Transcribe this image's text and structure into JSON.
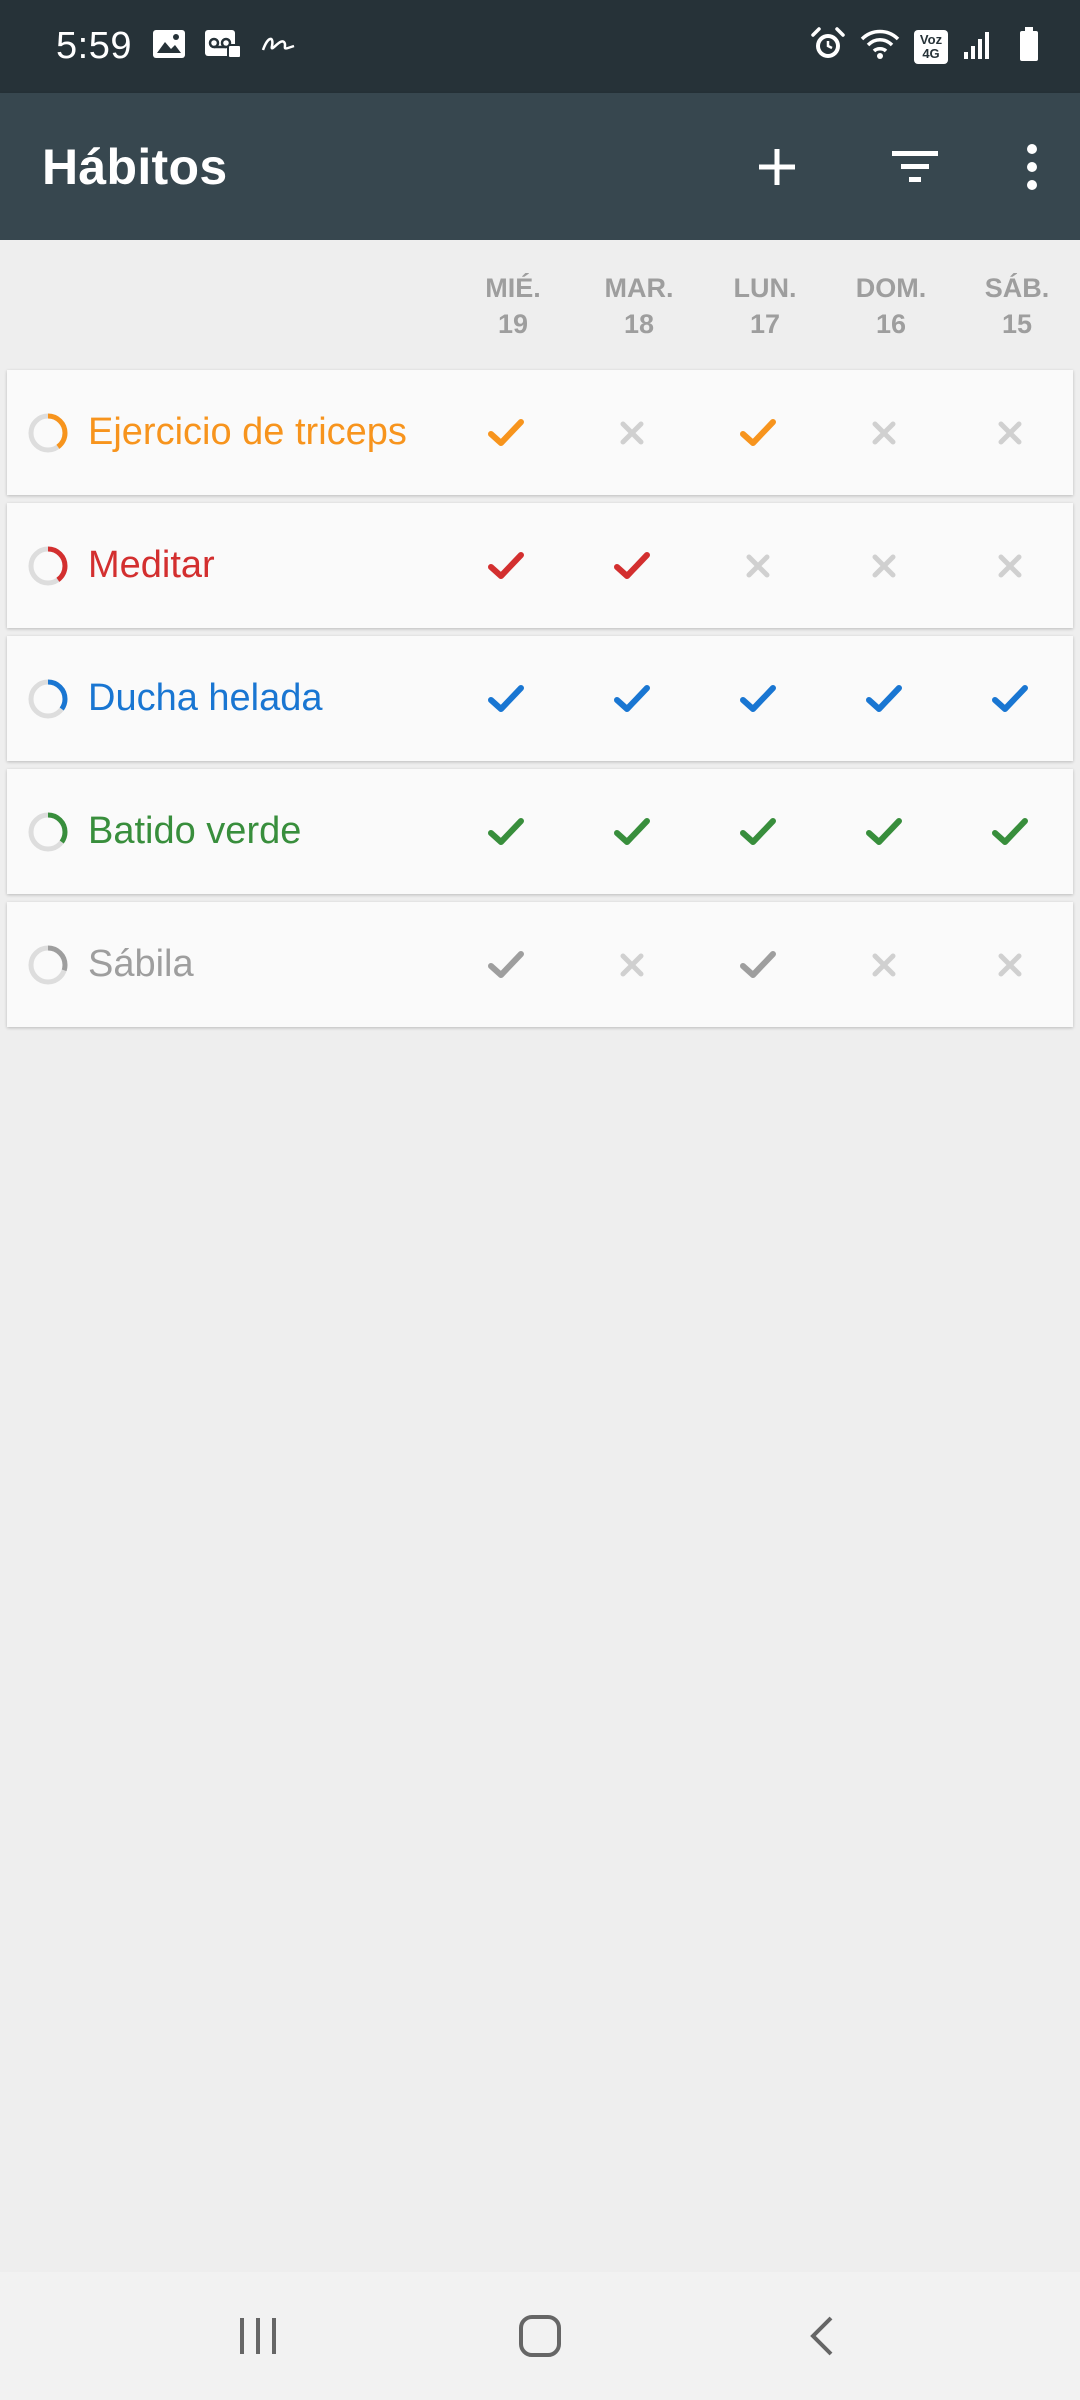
{
  "status_bar": {
    "time": "5:59",
    "left_icons": [
      "image-icon",
      "voicemail-icon",
      "signature-icon"
    ],
    "right_icons": [
      "alarm-icon",
      "wifi-icon",
      "volte-4g-icon",
      "signal-icon",
      "battery-icon"
    ],
    "network_badge_top": "Voz",
    "network_badge_bottom": "4G"
  },
  "app_bar": {
    "title": "Hábitos",
    "actions": [
      "add-icon",
      "filter-icon",
      "more-vert-icon"
    ]
  },
  "days": [
    {
      "name": "MIÉ.",
      "num": "19"
    },
    {
      "name": "MAR.",
      "num": "18"
    },
    {
      "name": "LUN.",
      "num": "17"
    },
    {
      "name": "DOM.",
      "num": "16"
    },
    {
      "name": "SÁB.",
      "num": "15"
    }
  ],
  "colors": {
    "check_off": "#d0d0d0",
    "ring_track": "#dddddd"
  },
  "habits": [
    {
      "name": "Ejercicio de triceps",
      "color": "#f7941d",
      "progress": 0.4,
      "checks": [
        true,
        false,
        true,
        false,
        false
      ]
    },
    {
      "name": "Meditar",
      "color": "#d32f2f",
      "progress": 0.4,
      "checks": [
        true,
        true,
        false,
        false,
        false
      ]
    },
    {
      "name": "Ducha helada",
      "color": "#1976d2",
      "progress": 0.35,
      "checks": [
        true,
        true,
        true,
        true,
        true
      ]
    },
    {
      "name": "Batido verde",
      "color": "#388e3c",
      "progress": 0.35,
      "checks": [
        true,
        true,
        true,
        true,
        true
      ]
    },
    {
      "name": "Sábila",
      "color": "#9e9e9e",
      "progress": 0.3,
      "checks": [
        true,
        false,
        true,
        false,
        false
      ]
    }
  ],
  "nav_bar": [
    "recent-apps-icon",
    "home-icon",
    "back-icon"
  ]
}
